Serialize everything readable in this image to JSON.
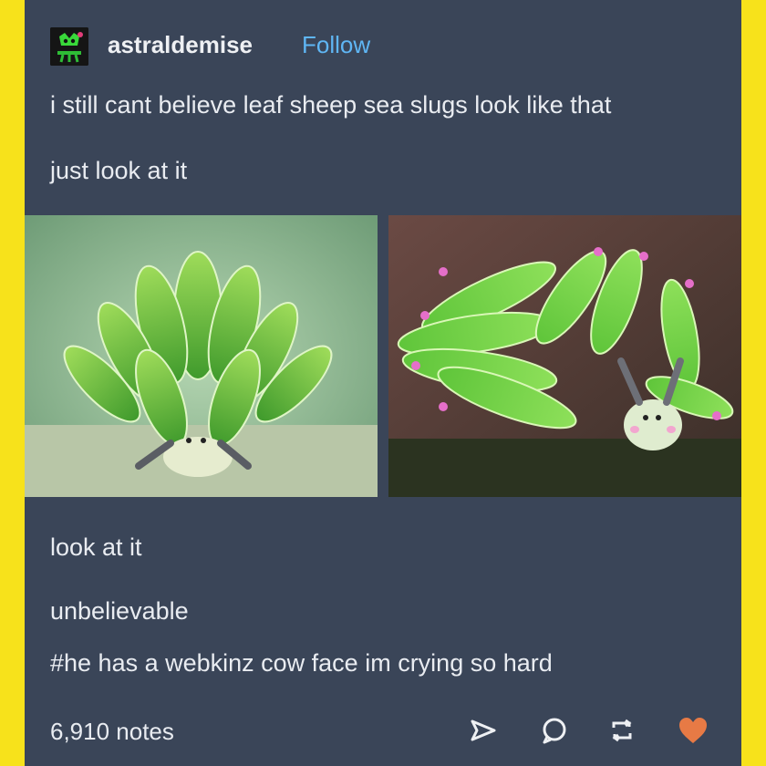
{
  "post": {
    "username": "astraldemise",
    "follow_label": "Follow",
    "line1": "i still cant believe leaf sheep sea slugs look like that",
    "line2": "just look at it",
    "line3": "look at it",
    "line4": "unbelievable",
    "tag": "#he has a webkinz cow face im crying so hard",
    "notes": "6,910 notes"
  },
  "icons": {
    "share": "send-icon",
    "reply": "reply-bubble-icon",
    "reblog": "reblog-icon",
    "like": "heart-icon"
  },
  "colors": {
    "background": "#f7e21b",
    "post": "#3a4558",
    "follow": "#5fb6f4",
    "like": "#e77a45"
  }
}
